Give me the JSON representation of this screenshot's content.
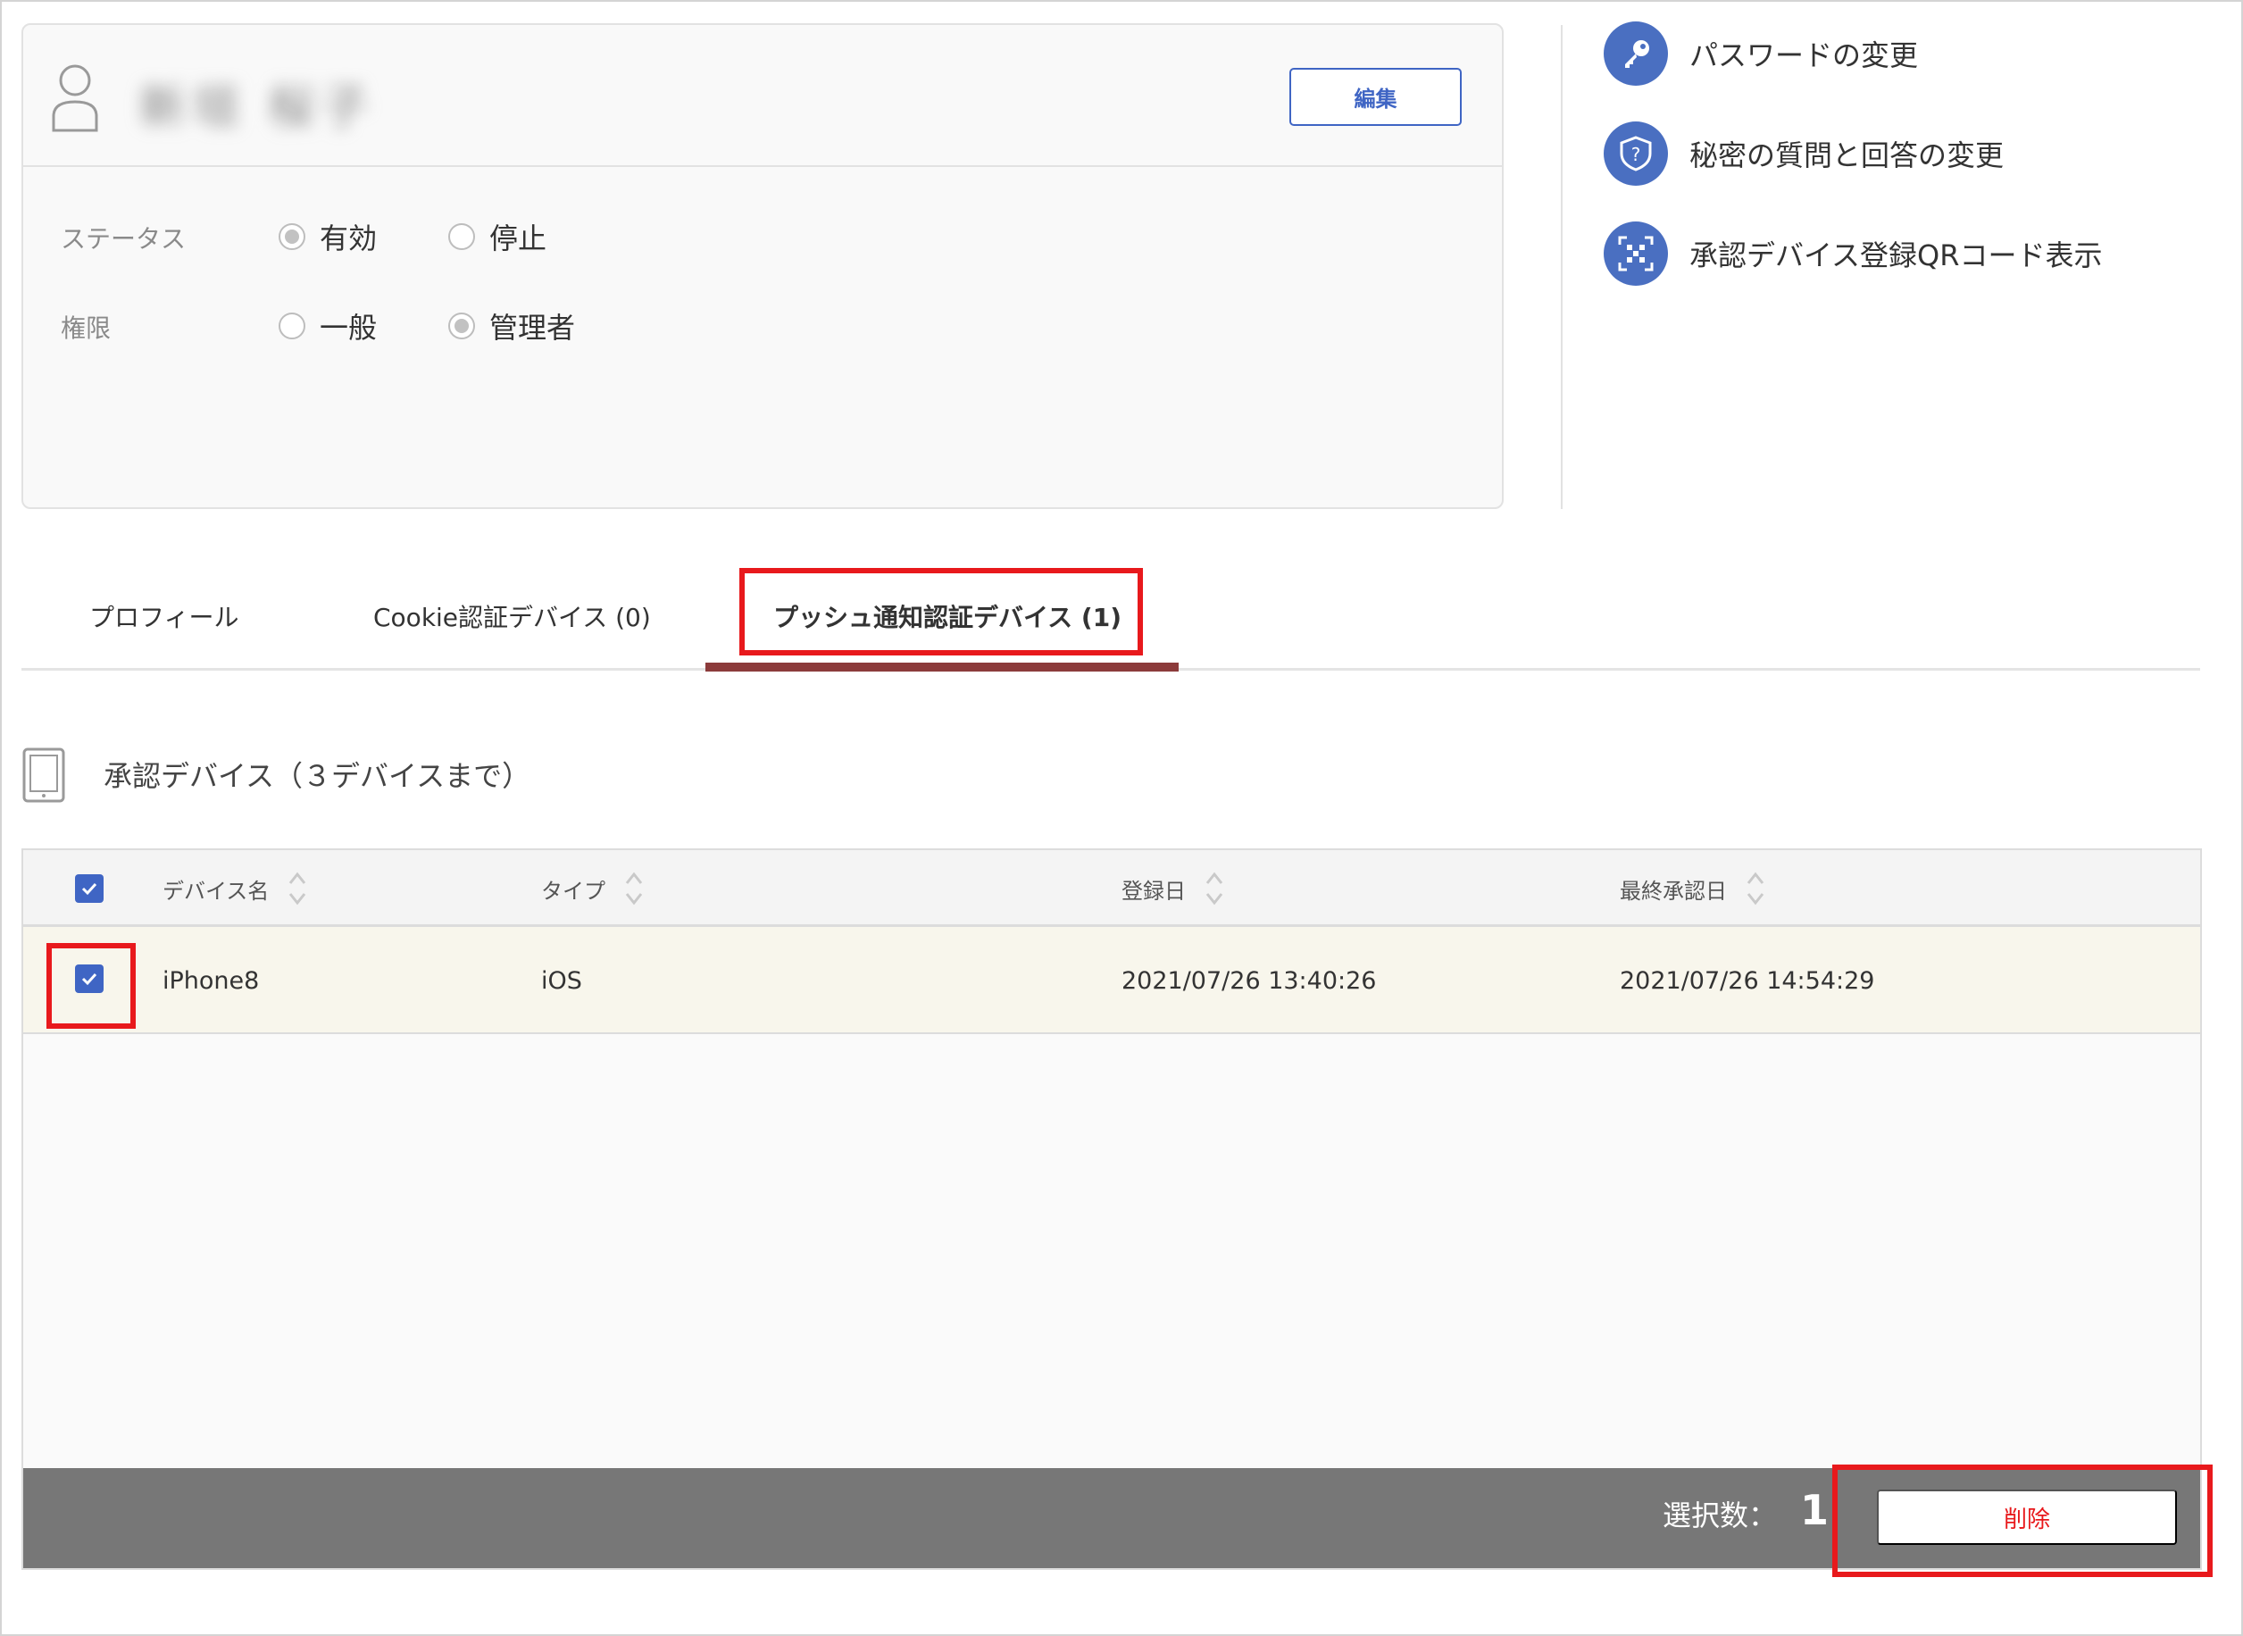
{
  "profile": {
    "user_name": "新垣 桜子",
    "edit_label": "編集",
    "status_label": "ステータス",
    "status_options": [
      "有効",
      "停止"
    ],
    "status_selected": "有効",
    "role_label": "権限",
    "role_options": [
      "一般",
      "管理者"
    ],
    "role_selected": "管理者"
  },
  "actions": [
    {
      "label": "パスワードの変更",
      "icon": "key-icon"
    },
    {
      "label": "秘密の質問と回答の変更",
      "icon": "shield-question-icon"
    },
    {
      "label": "承認デバイス登録QRコード表示",
      "icon": "qr-code-icon"
    }
  ],
  "tabs": [
    {
      "label": "プロフィール"
    },
    {
      "label": "Cookie認証デバイス (0)"
    },
    {
      "label": "プッシュ通知認証デバイス (1)",
      "active": true
    }
  ],
  "section": {
    "title": "承認デバイス（３デバイスまで）"
  },
  "table": {
    "columns": [
      "デバイス名",
      "タイプ",
      "登録日",
      "最終承認日"
    ],
    "rows": [
      {
        "name": "iPhone8",
        "type": "iOS",
        "registered": "2021/07/26 13:40:26",
        "last_approved": "2021/07/26 14:54:29",
        "checked": true
      }
    ],
    "header_checked": true
  },
  "footer": {
    "selected_label": "選択数：",
    "selected_count": "1",
    "delete_label": "削除"
  },
  "colors": {
    "accent": "#3f65c4",
    "icon_bg": "#4a6fc1",
    "highlight": "#e8191c",
    "tab_active": "#8c3b3b",
    "footer_bg": "#777777",
    "row_selected": "#f8f6ec"
  }
}
